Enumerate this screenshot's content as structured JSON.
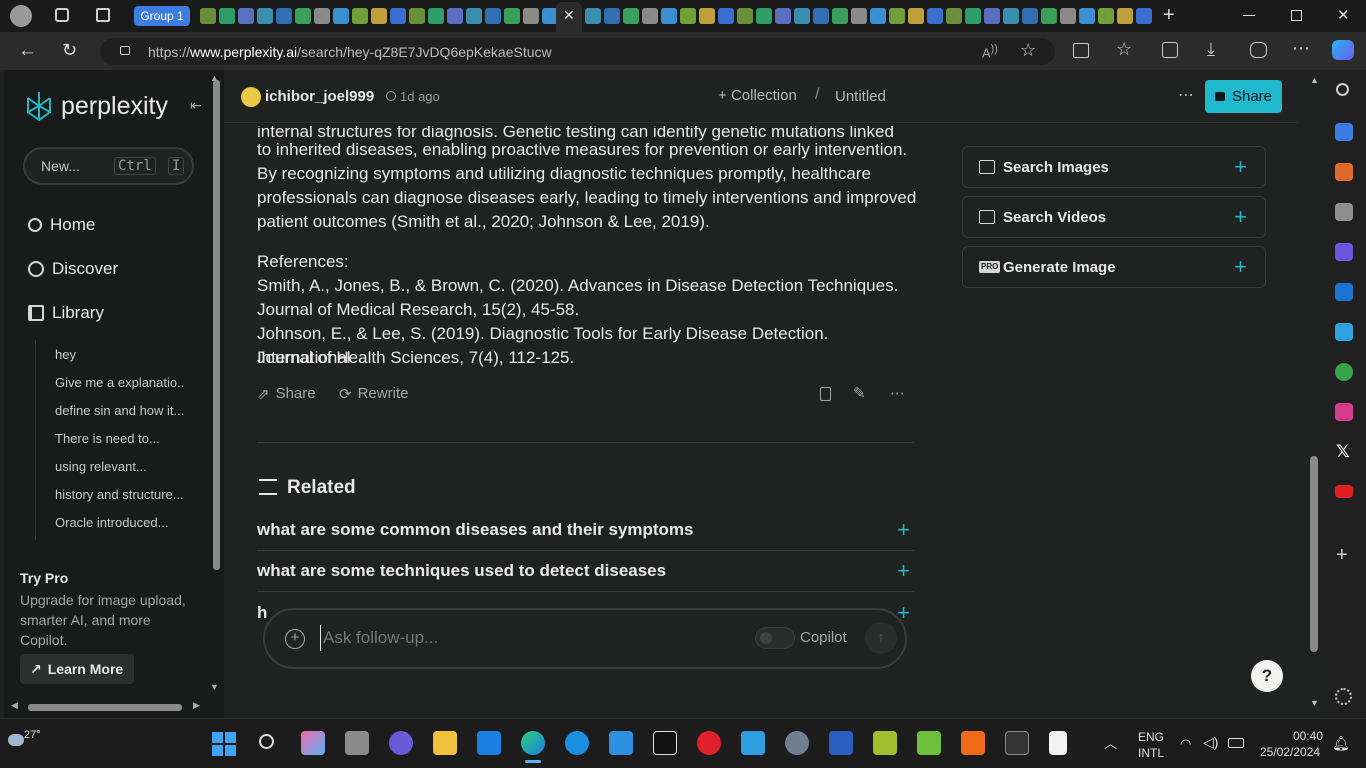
{
  "browser": {
    "tab_group_label": "Group 1",
    "url_prefix": "https://",
    "url_domain": "www.perplexity.ai",
    "url_path": "/search/hey-qZ8E7JvDQ6epKekaeStucw"
  },
  "sidebar": {
    "brand": "perplexity",
    "new_label": "New...",
    "new_shortcut_1": "Ctrl",
    "new_shortcut_2": "I",
    "nav": [
      {
        "label": "Home"
      },
      {
        "label": "Discover"
      },
      {
        "label": "Library"
      }
    ],
    "library": [
      "hey",
      "Give me a explanatio...",
      "define sin and how it...",
      "There is need to...",
      "using relevant...",
      "history and structure...",
      "Oracle introduced..."
    ],
    "promo": {
      "title": "Try Pro",
      "body": "Upgrade for image upload, smarter AI, and more Copilot.",
      "cta": "Learn More"
    }
  },
  "header": {
    "username": "ichibor_joel999",
    "time_ago": "1d ago",
    "collection_label": "Collection",
    "separator": "/",
    "thread_title": "Untitled",
    "share_label": "Share",
    "more_icon": "ellipsis-icon"
  },
  "answer": {
    "paragraph_lines": [
      "internal structures for diagnosis. Genetic testing can identify genetic mutations linked",
      "to inherited diseases, enabling proactive measures for prevention or early intervention.",
      "By recognizing symptoms and utilizing diagnostic techniques promptly, healthcare",
      "professionals can diagnose diseases early, leading to timely interventions and improved",
      "patient outcomes (Smith et al., 2020; Johnson & Lee, 2019)."
    ],
    "references_lines": [
      "References:",
      "Smith, A., Jones, B., & Brown, C. (2020). Advances in Disease Detection Techniques.",
      "Journal of Medical Research, 15(2), 45-58.",
      "Johnson, E., & Lee, S. (2019). Diagnostic Tools for Early Disease Detection. International",
      "Journal of Health Sciences, 7(4), 112-125."
    ],
    "actions": {
      "share": "Share",
      "rewrite": "Rewrite"
    }
  },
  "related": {
    "title": "Related",
    "items": [
      "what are some common diseases and their symptoms",
      "what are some techniques used to detect diseases",
      "h"
    ]
  },
  "right_panel": {
    "buttons": [
      {
        "label": "Search Images",
        "icon": "image-icon"
      },
      {
        "label": "Search Videos",
        "icon": "film-icon"
      },
      {
        "label": "Generate Image",
        "icon": "pro-badge-icon",
        "badge": "PRO"
      }
    ]
  },
  "composer": {
    "placeholder": "Ask follow-up...",
    "copilot_label": "Copilot"
  },
  "help_label": "?",
  "taskbar": {
    "weather": "27°",
    "lang_1": "ENG",
    "lang_2": "INTL",
    "time": "00:40",
    "date": "25/02/2024"
  },
  "colors": {
    "accent": "#26b5c5",
    "share_bg": "#1fb8cd",
    "bg": "#202222",
    "sidebar_bg": "#191a1a"
  }
}
